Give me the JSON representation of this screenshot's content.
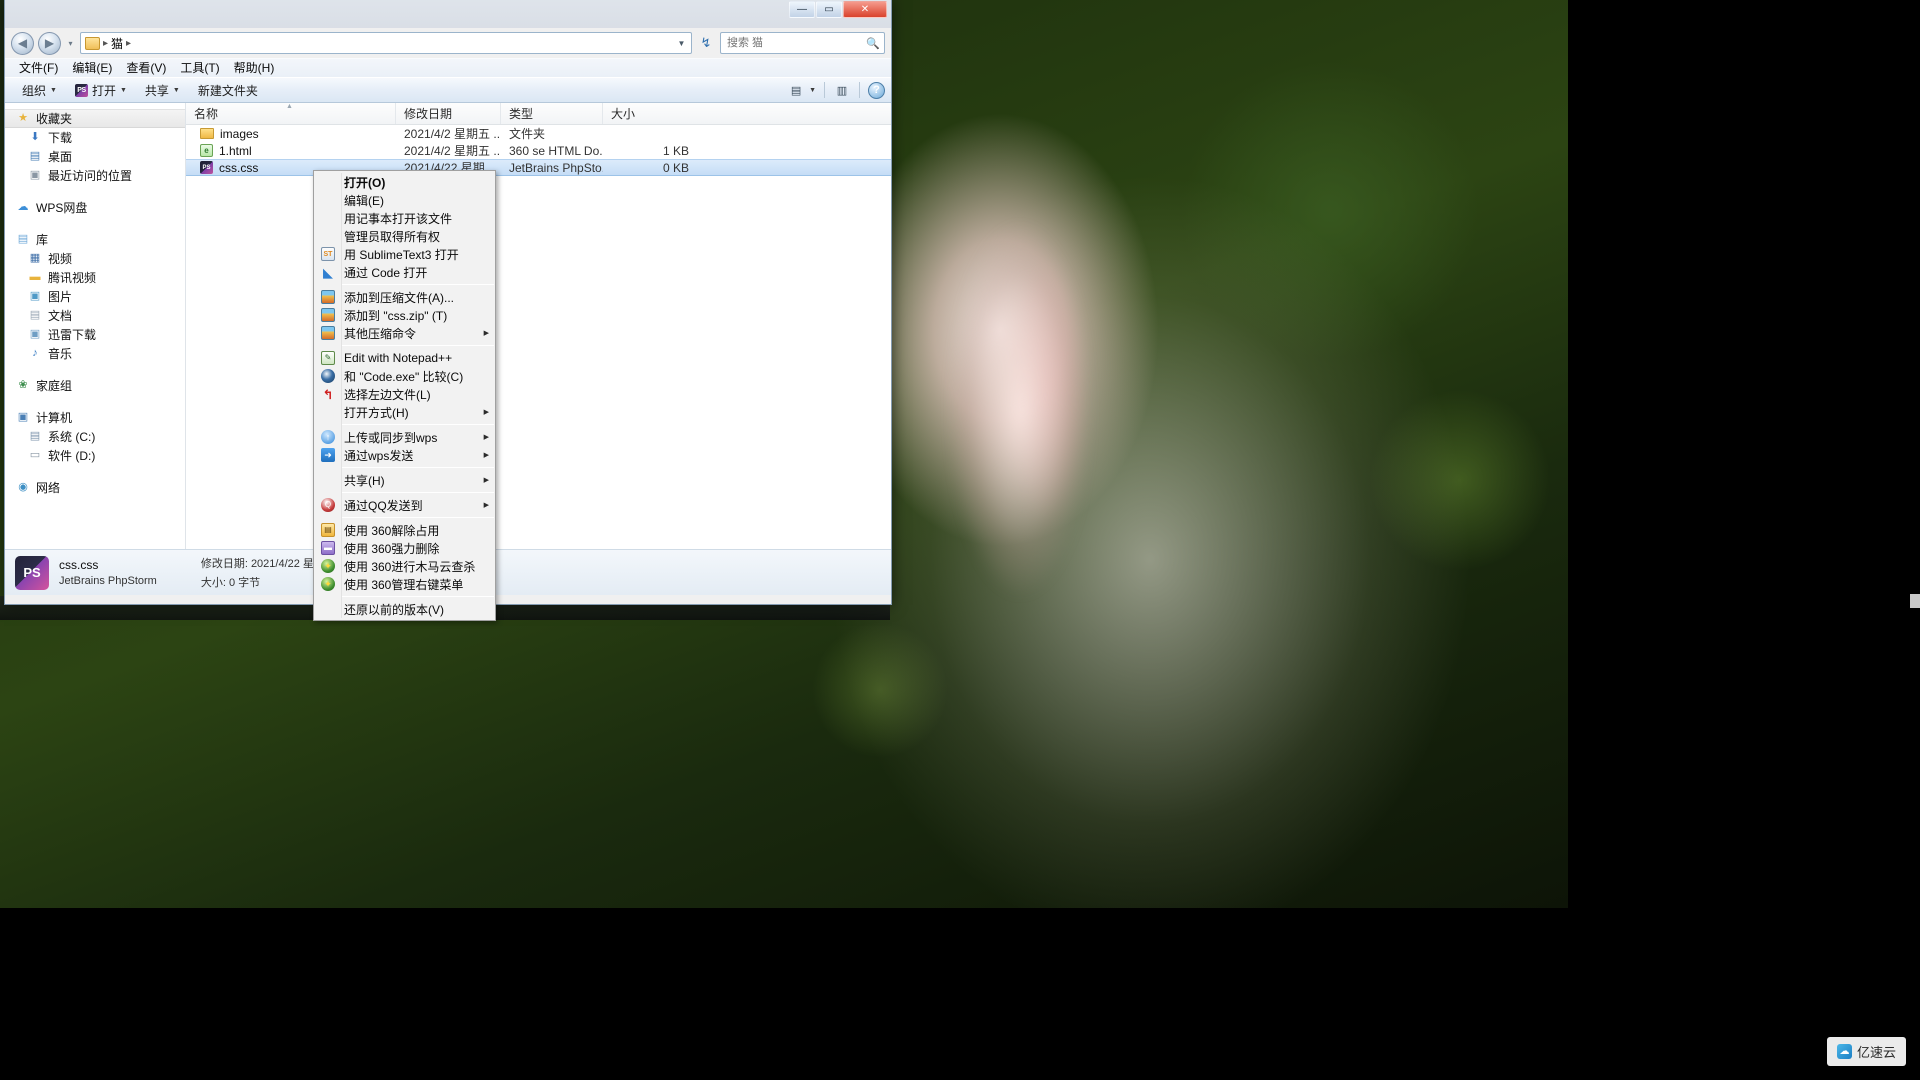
{
  "window": {
    "title": "",
    "controls": {
      "minimize": "—",
      "maximize": "▭",
      "close": "✕"
    }
  },
  "address": {
    "folder_icon": "folder-icon",
    "crumb": "猫",
    "separator": "▸",
    "leading_separator": "▸",
    "dropdown_icon": "▼",
    "refresh_icon": "↯",
    "back_icon": "◀",
    "forward_icon": "▶",
    "recent_caret": "▾"
  },
  "search": {
    "placeholder": "搜索 猫",
    "value": "",
    "icon": "search-icon"
  },
  "menubar": {
    "items": [
      {
        "label": "文件(F)"
      },
      {
        "label": "编辑(E)"
      },
      {
        "label": "查看(V)"
      },
      {
        "label": "工具(T)"
      },
      {
        "label": "帮助(H)"
      }
    ]
  },
  "toolbar": {
    "organize": "组织",
    "open": "打开",
    "share": "共享",
    "new_folder": "新建文件夹",
    "caret": "▼",
    "open_icon_text": "PS",
    "view_icon": "▤",
    "view_caret": "▼",
    "preview_icon": "▥",
    "help_icon": "?"
  },
  "sidebar": {
    "groups": [
      {
        "header": {
          "label": "收藏夹",
          "icon": "star-icon",
          "glyph": "★",
          "color": "#e8b33c",
          "selected": true
        },
        "items": [
          {
            "label": "下载",
            "icon": "downloads-icon",
            "glyph": "⬇",
            "color": "#3a78c2"
          },
          {
            "label": "桌面",
            "icon": "desktop-icon",
            "glyph": "▤",
            "color": "#4a7fb5"
          },
          {
            "label": "最近访问的位置",
            "icon": "recent-places-icon",
            "glyph": "▣",
            "color": "#8a97a4"
          }
        ]
      },
      {
        "header": {
          "label": "WPS网盘",
          "icon": "cloud-icon",
          "glyph": "☁",
          "color": "#3d8fd8",
          "selected": false
        },
        "items": []
      },
      {
        "header": {
          "label": "库",
          "icon": "library-icon",
          "glyph": "▤",
          "color": "#6fa8d8",
          "selected": false
        },
        "items": [
          {
            "label": "视频",
            "icon": "video-icon",
            "glyph": "▦",
            "color": "#3f6fa8"
          },
          {
            "label": "腾讯视频",
            "icon": "folder-icon",
            "glyph": "▬",
            "color": "#e8b33c"
          },
          {
            "label": "图片",
            "icon": "pictures-icon",
            "glyph": "▣",
            "color": "#4f9ac7"
          },
          {
            "label": "文档",
            "icon": "documents-icon",
            "glyph": "▤",
            "color": "#9aa7b4"
          },
          {
            "label": "迅雷下载",
            "icon": "thunder-download-icon",
            "glyph": "▣",
            "color": "#6f9ec4"
          },
          {
            "label": "音乐",
            "icon": "music-icon",
            "glyph": "♪",
            "color": "#3d7fc4"
          }
        ]
      },
      {
        "header": {
          "label": "家庭组",
          "icon": "homegroup-icon",
          "glyph": "❀",
          "color": "#3f8f4f",
          "selected": false
        },
        "items": []
      },
      {
        "header": {
          "label": "计算机",
          "icon": "computer-icon",
          "glyph": "▣",
          "color": "#4a7fb5",
          "selected": false
        },
        "items": [
          {
            "label": "系统 (C:)",
            "icon": "system-drive-icon",
            "glyph": "▤",
            "color": "#7f96ad"
          },
          {
            "label": "软件 (D:)",
            "icon": "drive-icon",
            "glyph": "▭",
            "color": "#8a97a4"
          }
        ]
      },
      {
        "header": {
          "label": "网络",
          "icon": "network-icon",
          "glyph": "◉",
          "color": "#3d8fc4",
          "selected": false
        },
        "items": []
      }
    ]
  },
  "filelist": {
    "columns": [
      {
        "label": "名称",
        "key": "name"
      },
      {
        "label": "修改日期",
        "key": "date"
      },
      {
        "label": "类型",
        "key": "type"
      },
      {
        "label": "大小",
        "key": "size"
      }
    ],
    "sort_indicator": "▲",
    "rows": [
      {
        "name": "images",
        "date": "2021/4/2 星期五 ...",
        "type": "文件夹",
        "size": "",
        "icon": "folder-icon",
        "selected": false
      },
      {
        "name": "1.html",
        "date": "2021/4/2 星期五 ...",
        "type": "360 se HTML Do...",
        "size": "1 KB",
        "icon": "html-file-icon",
        "icon_text": "e",
        "selected": false
      },
      {
        "name": "css.css",
        "date": "2021/4/22 星期...",
        "type": "JetBrains PhpSto...",
        "size": "0 KB",
        "icon": "phpstorm-file-icon",
        "icon_text": "PS",
        "selected": true
      }
    ]
  },
  "statusbar": {
    "icon": "phpstorm-icon",
    "icon_text": "PS",
    "filename": "css.css",
    "apptype": "JetBrains PhpStorm",
    "date_label": "修改日期: 2021/4/22 星期四 18:",
    "size_label": "大小: 0 字节"
  },
  "contextmenu": {
    "items": [
      {
        "label": "打开(O)",
        "bold": true,
        "icon": null,
        "submenu": false
      },
      {
        "label": "编辑(E)",
        "bold": false,
        "icon": null,
        "submenu": false
      },
      {
        "label": "用记事本打开该文件",
        "bold": false,
        "icon": null,
        "submenu": false
      },
      {
        "label": "管理员取得所有权",
        "bold": false,
        "icon": null,
        "submenu": false
      },
      {
        "label": "用 SublimeText3 打开",
        "bold": false,
        "icon": "sublime-text-icon",
        "glyph": "ST",
        "iconclass": "ic-sublime",
        "submenu": false
      },
      {
        "label": "通过 Code 打开",
        "bold": false,
        "icon": "vscode-icon",
        "glyph": "◣",
        "iconclass": "ic-vscode",
        "submenu": false
      },
      {
        "separator": true
      },
      {
        "label": "添加到压缩文件(A)...",
        "bold": false,
        "icon": "winrar-icon",
        "glyph": "",
        "iconclass": "ic-rar",
        "submenu": false
      },
      {
        "label": "添加到 \"css.zip\" (T)",
        "bold": false,
        "icon": "winrar-icon",
        "glyph": "",
        "iconclass": "ic-rar",
        "submenu": false
      },
      {
        "label": "其他压缩命令",
        "bold": false,
        "icon": "winrar-icon",
        "glyph": "",
        "iconclass": "ic-rar",
        "submenu": true
      },
      {
        "separator": true
      },
      {
        "label": "Edit with Notepad++",
        "bold": false,
        "icon": "notepadpp-icon",
        "glyph": "✎",
        "iconclass": "ic-npp",
        "submenu": false
      },
      {
        "label": "和 \"Code.exe\" 比较(C)",
        "bold": false,
        "icon": "beyond-compare-icon",
        "glyph": "",
        "iconclass": "ic-code-cmp",
        "submenu": false
      },
      {
        "label": "选择左边文件(L)",
        "bold": false,
        "icon": "select-left-icon",
        "glyph": "↰",
        "iconclass": "ic-undo",
        "submenu": false
      },
      {
        "label": "打开方式(H)",
        "bold": false,
        "icon": null,
        "submenu": true
      },
      {
        "separator": true
      },
      {
        "label": "上传或同步到wps",
        "bold": false,
        "icon": "wps-upload-icon",
        "glyph": "↑",
        "iconclass": "ic-wps-up",
        "submenu": true
      },
      {
        "label": "通过wps发送",
        "bold": false,
        "icon": "wps-send-icon",
        "glyph": "➜",
        "iconclass": "ic-wps-send",
        "submenu": true
      },
      {
        "separator": true
      },
      {
        "label": "共享(H)",
        "bold": false,
        "icon": null,
        "submenu": true
      },
      {
        "separator": true
      },
      {
        "label": "通过QQ发送到",
        "bold": false,
        "icon": "qq-icon",
        "glyph": "Q",
        "iconclass": "ic-qq",
        "submenu": true
      },
      {
        "separator": true
      },
      {
        "label": "使用 360解除占用",
        "bold": false,
        "icon": "360-unlock-icon",
        "glyph": "▤",
        "iconclass": "ic-360a",
        "submenu": false
      },
      {
        "label": "使用 360强力删除",
        "bold": false,
        "icon": "360-force-delete-icon",
        "glyph": "▬",
        "iconclass": "ic-360b",
        "submenu": false
      },
      {
        "label": "使用 360进行木马云查杀",
        "bold": false,
        "icon": "360-scan-icon",
        "glyph": "✦",
        "iconclass": "ic-360c",
        "submenu": false
      },
      {
        "label": "使用 360管理右键菜单",
        "bold": false,
        "icon": "360-menu-manage-icon",
        "glyph": "✦",
        "iconclass": "ic-360c",
        "submenu": false
      },
      {
        "separator": true
      },
      {
        "label": "还原以前的版本(V)",
        "bold": false,
        "icon": null,
        "submenu": false
      }
    ]
  },
  "watermark": {
    "text": "亿速云",
    "icon": "cloud-logo-icon",
    "glyph": "☁"
  },
  "colors": {
    "selection_blue": "#c5ddf6",
    "accent": "#3a6ea5",
    "close_red": "#d9422c"
  }
}
